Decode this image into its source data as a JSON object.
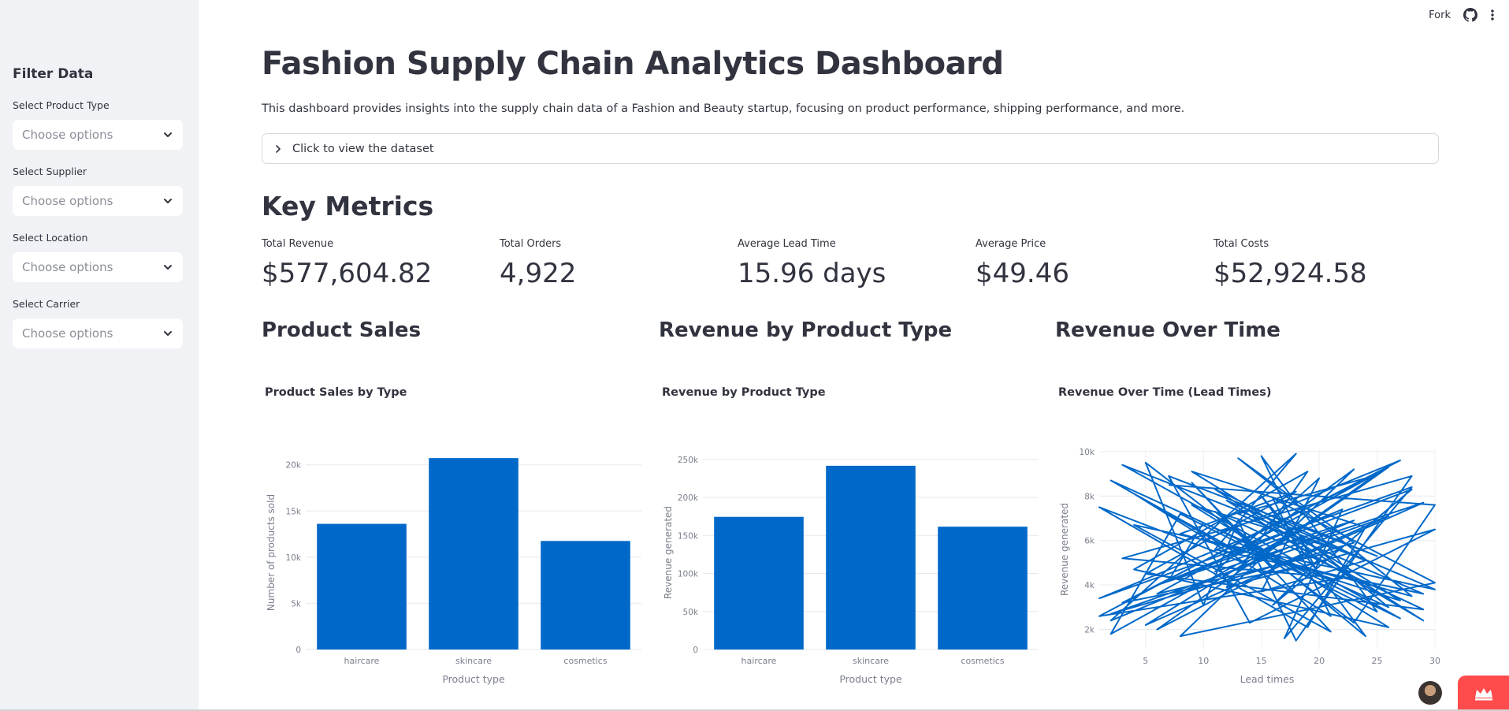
{
  "sidebar": {
    "title": "Filter Data",
    "filters": [
      {
        "label": "Select Product Type",
        "placeholder": "Choose options"
      },
      {
        "label": "Select Supplier",
        "placeholder": "Choose options"
      },
      {
        "label": "Select Location",
        "placeholder": "Choose options"
      },
      {
        "label": "Select Carrier",
        "placeholder": "Choose options"
      }
    ]
  },
  "toolbar": {
    "fork_label": "Fork",
    "github_icon": "github-icon",
    "menu_icon": "kebab-menu-icon"
  },
  "header": {
    "title": "Fashion Supply Chain Analytics Dashboard",
    "description": "This dashboard provides insights into the supply chain data of a Fashion and Beauty startup, focusing on product performance, shipping performance, and more.",
    "expander_label": "Click to view the dataset"
  },
  "key_metrics": {
    "heading": "Key Metrics",
    "items": [
      {
        "label": "Total Revenue",
        "value": "$577,604.82"
      },
      {
        "label": "Total Orders",
        "value": "4,922"
      },
      {
        "label": "Average Lead Time",
        "value": "15.96 days"
      },
      {
        "label": "Average Price",
        "value": "$49.46"
      },
      {
        "label": "Total Costs",
        "value": "$52,924.58"
      }
    ]
  },
  "sections": {
    "product_sales": "Product Sales",
    "revenue_by_type": "Revenue by Product Type",
    "revenue_over_time": "Revenue Over Time"
  },
  "colors": {
    "bar": "#0068c9",
    "sidebar_bg": "#f0f2f6",
    "deploy": "#ff4b4b",
    "text": "#31333f"
  },
  "chart_data": [
    {
      "type": "bar",
      "title": "Product Sales by Type",
      "xlabel": "Product type",
      "ylabel": "Number of products sold",
      "categories": [
        "haircare",
        "skincare",
        "cosmetics"
      ],
      "values": [
        13611,
        20731,
        11757
      ],
      "ylim": [
        0,
        21000
      ],
      "yticks": [
        {
          "v": 0,
          "label": "0"
        },
        {
          "v": 5000,
          "label": "5k"
        },
        {
          "v": 10000,
          "label": "10k"
        },
        {
          "v": 15000,
          "label": "15k"
        },
        {
          "v": 20000,
          "label": "20k"
        }
      ],
      "grid": true
    },
    {
      "type": "bar",
      "title": "Revenue by Product Type",
      "xlabel": "Product type",
      "ylabel": "Revenue generated",
      "categories": [
        "haircare",
        "skincare",
        "cosmetics"
      ],
      "values": [
        174455,
        241628,
        161521
      ],
      "ylim": [
        0,
        255000
      ],
      "yticks": [
        {
          "v": 0,
          "label": "0"
        },
        {
          "v": 50000,
          "label": "50k"
        },
        {
          "v": 100000,
          "label": "100k"
        },
        {
          "v": 150000,
          "label": "150k"
        },
        {
          "v": 200000,
          "label": "200k"
        },
        {
          "v": 250000,
          "label": "250k"
        }
      ],
      "grid": true
    },
    {
      "type": "line",
      "title": "Revenue Over Time (Lead Times)",
      "xlabel": "Lead times",
      "ylabel": "Revenue generated",
      "xlim": [
        1,
        30
      ],
      "ylim": [
        1100,
        10100
      ],
      "xticks": [
        {
          "v": 5,
          "label": "5"
        },
        {
          "v": 10,
          "label": "10"
        },
        {
          "v": 15,
          "label": "15"
        },
        {
          "v": 20,
          "label": "20"
        },
        {
          "v": 25,
          "label": "25"
        },
        {
          "v": 30,
          "label": "30"
        }
      ],
      "yticks": [
        {
          "v": 2000,
          "label": "2k"
        },
        {
          "v": 4000,
          "label": "4k"
        },
        {
          "v": 6000,
          "label": "6k"
        },
        {
          "v": 8000,
          "label": "8k"
        },
        {
          "v": 10000,
          "label": "10k"
        }
      ],
      "grid": true,
      "x": [
        7,
        30,
        23,
        5,
        10,
        13,
        18,
        28,
        3,
        20,
        15,
        25,
        8,
        2,
        17,
        29,
        11,
        22,
        6,
        26,
        14,
        1,
        19,
        24,
        9,
        27,
        12,
        4,
        21,
        16,
        30,
        8,
        23,
        13,
        2,
        26,
        18,
        5,
        29,
        11,
        20,
        15,
        24,
        3,
        27,
        10,
        7,
        22,
        17,
        28,
        1,
        14,
        25,
        6,
        19,
        12,
        30,
        4,
        21,
        9,
        16,
        26,
        2,
        23,
        13,
        28,
        8,
        18,
        5,
        29,
        11,
        24,
        15,
        20,
        3,
        27,
        10,
        22,
        1,
        17,
        25,
        7,
        14,
        30,
        12,
        19,
        4,
        26,
        9,
        21,
        16,
        28,
        6,
        23,
        2,
        18,
        11,
        29,
        13,
        24
      ],
      "y": [
        8500,
        7600,
        2300,
        9500,
        3100,
        6900,
        1500,
        8900,
        5200,
        4400,
        9800,
        2800,
        7200,
        1800,
        6100,
        2400,
        8300,
        5600,
        3600,
        9300,
        4900,
        7500,
        2100,
        6600,
        9100,
        3300,
        5800,
        8100,
        2600,
        7900,
        4100,
        1700,
        9200,
        5400,
        8700,
        3000,
        6400,
        2200,
        7700,
        4600,
        8800,
        3700,
        5100,
        9400,
        2500,
        6800,
        4200,
        7400,
        1600,
        8400,
        3400,
        6200,
        9000,
        2000,
        5500,
        7800,
        3800,
        6700,
        1900,
        8600,
        4800,
        7100,
        2700,
        5900,
        9700,
        3500,
        6300,
        8200,
        4500,
        2900,
        7300,
        1700,
        8000,
        5000,
        3200,
        9600,
        6000,
        4300,
        2600,
        7000,
        5300,
        8900,
        2300,
        6500,
        3900,
        9100,
        4700,
        2100,
        7600,
        5700,
        3100,
        8300,
        4000,
        6900,
        2400,
        9900,
        5600,
        3600,
        7200,
        8800
      ]
    }
  ]
}
